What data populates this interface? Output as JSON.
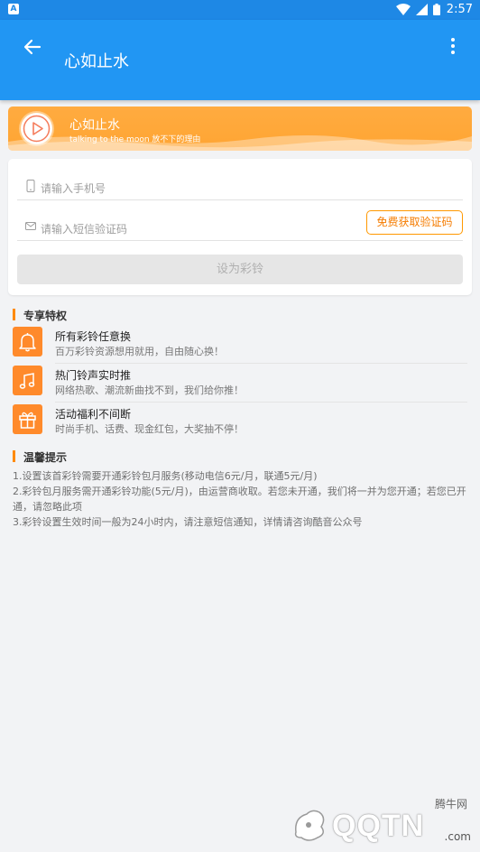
{
  "status_bar": {
    "app_icon_letter": "A",
    "time": "2:57"
  },
  "app_bar": {
    "title": "心如止水"
  },
  "banner": {
    "title": "心如止水",
    "subtitle": "talking to the moon 放不下的理由"
  },
  "form": {
    "phone_placeholder": "请输入手机号",
    "code_placeholder": "请输入短信验证码",
    "get_code_label": "免费获取验证码",
    "set_ringtone_label": "设为彩铃"
  },
  "privileges": {
    "title": "专享特权",
    "items": [
      {
        "icon": "bell-icon",
        "title": "所有彩铃任意换",
        "desc": "百万彩铃资源想用就用，自由随心换！"
      },
      {
        "icon": "music-note-icon",
        "title": "热门铃声实时推",
        "desc": "网络热歌、潮流新曲找不到，我们给你推！"
      },
      {
        "icon": "gift-icon",
        "title": "活动福利不间断",
        "desc": "时尚手机、话费、现金红包，大奖抽不停！"
      }
    ]
  },
  "tips": {
    "title": "温馨提示",
    "lines": [
      "1.设置该首彩铃需要开通彩铃包月服务(移动电信6元/月，联通5元/月)",
      "2.彩铃包月服务需开通彩铃功能(5元/月)，由运营商收取。若您未开通，我们将一并为您开通；若您已开通，请忽略此项",
      "3.彩铃设置生效时间一般为24小时内，请注意短信通知，详情请咨询酷音公众号"
    ]
  },
  "watermark": {
    "cn": "腾牛网",
    "text": "QQTN",
    "domain": ".com"
  },
  "colors": {
    "primary": "#2196f3",
    "accent": "#ff8a2b",
    "banner": "#ffa533"
  }
}
